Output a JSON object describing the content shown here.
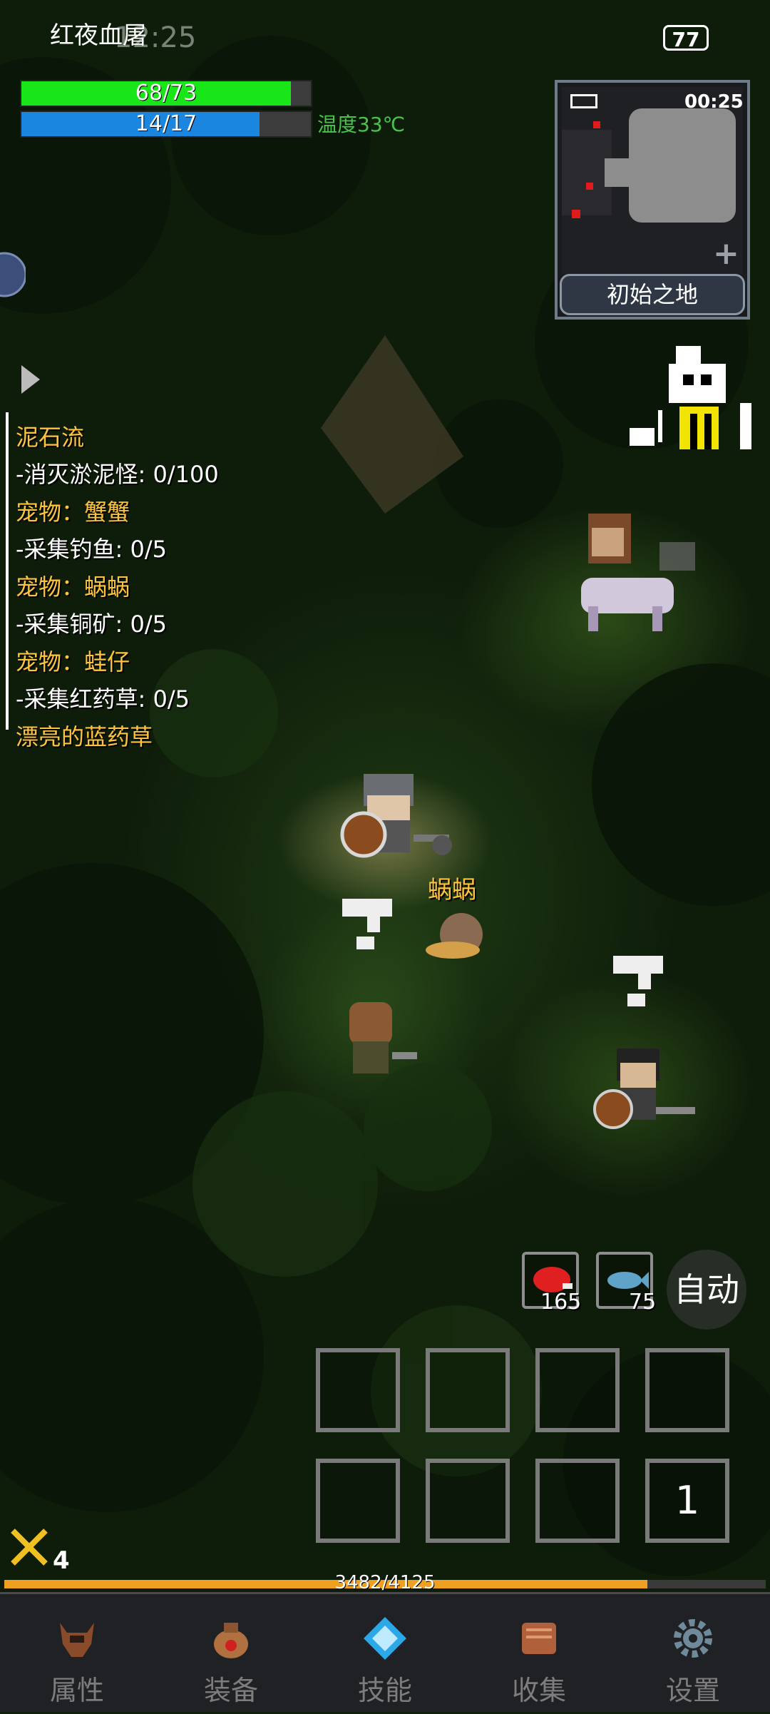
{
  "status": {
    "title": "红夜血屠",
    "time": "12:25",
    "battery": "77"
  },
  "player": {
    "hp": {
      "text": "68/73",
      "current": 68,
      "max": 73,
      "color": "#19e619"
    },
    "mp": {
      "text": "14/17",
      "current": 14,
      "max": 17,
      "color": "#1b86e0"
    },
    "temperature": "温度33℃"
  },
  "minimap": {
    "time": "00:25",
    "zone_name": "初始之地",
    "expand_icon": "plus-icon",
    "battery_icon": "battery-icon"
  },
  "quests": [
    {
      "title": "泥石流",
      "task": "-消灭淤泥怪: 0/100"
    },
    {
      "title": "宠物：蟹蟹",
      "task": "-采集钓鱼: 0/5"
    },
    {
      "title": "宠物：蜗蜗",
      "task": "-采集铜矿: 0/5"
    },
    {
      "title": "宠物：蛙仔",
      "task": "-采集红药草: 0/5"
    },
    {
      "title": "漂亮的蓝药草",
      "task": ""
    }
  ],
  "entities": {
    "pet_name": "蜗蜗"
  },
  "items": [
    {
      "icon": "meat-icon",
      "count": "165"
    },
    {
      "icon": "fish-icon",
      "count": "75"
    }
  ],
  "auto_label": "自动",
  "skill_slots": {
    "page_number": "1"
  },
  "level": {
    "value": "4",
    "icon": "crossed-swords-icon"
  },
  "experience": {
    "text": "3482/4125",
    "current": 3482,
    "max": 4125
  },
  "nav": [
    {
      "label": "属性",
      "icon": "helmet-icon"
    },
    {
      "label": "装备",
      "icon": "bag-icon"
    },
    {
      "label": "技能",
      "icon": "crystal-icon"
    },
    {
      "label": "收集",
      "icon": "book-icon"
    },
    {
      "label": "设置",
      "icon": "gear-icon"
    }
  ]
}
